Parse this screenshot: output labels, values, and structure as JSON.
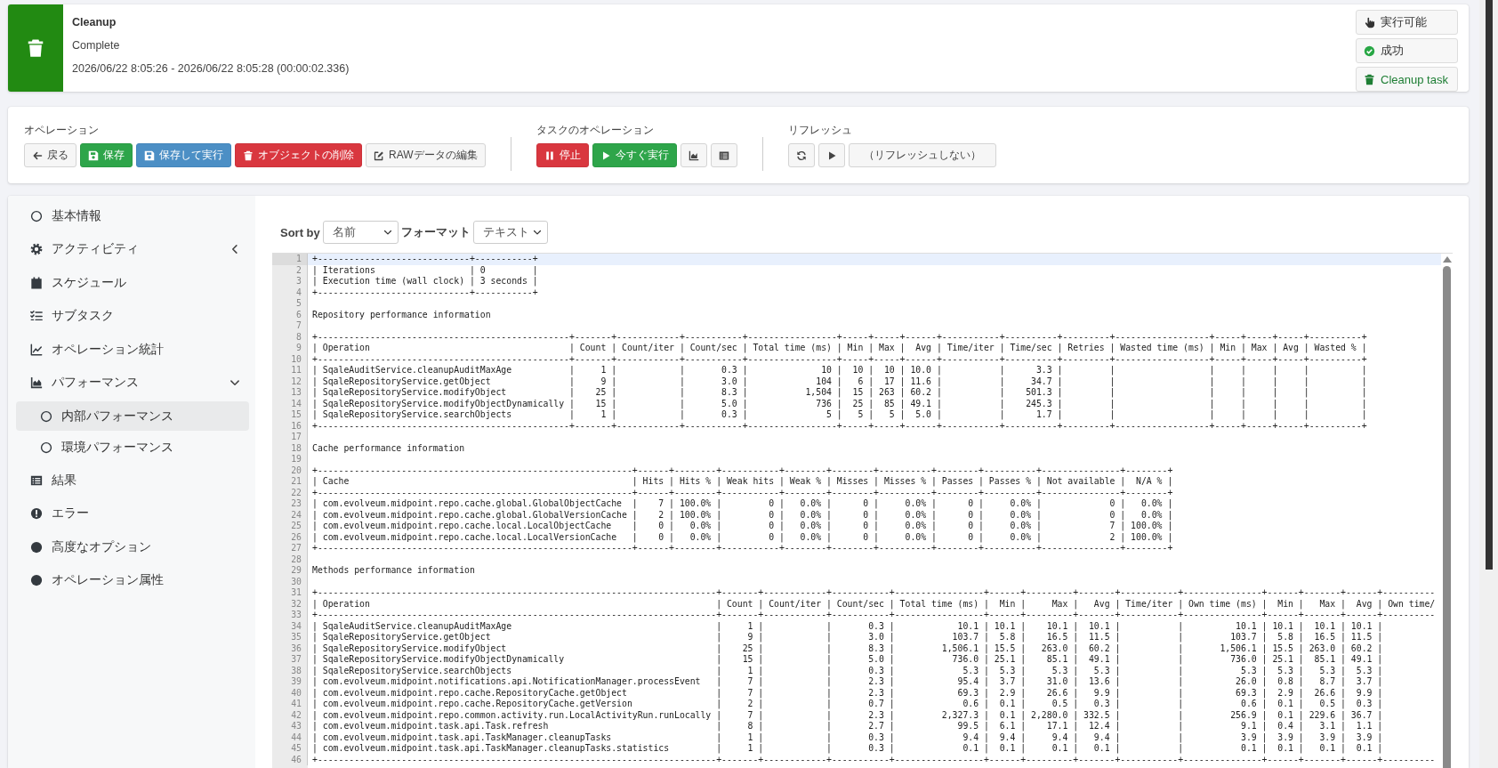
{
  "header": {
    "title": "Cleanup",
    "status": "Complete",
    "time": "2026/06/22 8:05:26 - 2026/06/22 8:05:28 (00:00:02.336)",
    "badges": [
      {
        "kind": "runnable",
        "label": "実行可能"
      },
      {
        "kind": "success",
        "label": "成功"
      },
      {
        "kind": "task",
        "label": "Cleanup task"
      }
    ]
  },
  "operations": {
    "groups": [
      {
        "label": "オペレーション",
        "buttons": [
          {
            "kind": "back",
            "label": "戻る"
          },
          {
            "kind": "save",
            "label": "保存"
          },
          {
            "kind": "save-run",
            "label": "保存して実行"
          },
          {
            "kind": "delete",
            "label": "オブジェクトの削除"
          },
          {
            "kind": "raw-edit",
            "label": "RAWデータの編集"
          }
        ]
      },
      {
        "label": "タスクのオペレーション",
        "buttons": [
          {
            "kind": "stop",
            "label": "停止"
          },
          {
            "kind": "run-now",
            "label": "今すぐ実行"
          },
          {
            "kind": "chart"
          },
          {
            "kind": "list"
          }
        ]
      },
      {
        "label": "リフレッシュ",
        "buttons": [
          {
            "kind": "refresh"
          },
          {
            "kind": "play"
          },
          {
            "kind": "refresh-mode",
            "label": "（リフレッシュしない）"
          }
        ]
      }
    ]
  },
  "sidebar": {
    "items": [
      {
        "kind": "basic",
        "label": "基本情報",
        "selected": false
      },
      {
        "kind": "activity",
        "label": "アクティビティ",
        "selected": false,
        "expanded": false
      },
      {
        "kind": "schedule",
        "label": "スケジュール",
        "selected": false
      },
      {
        "kind": "subtasks",
        "label": "サブタスク",
        "selected": false
      },
      {
        "kind": "statistics",
        "label": "オペレーション統計",
        "selected": false
      },
      {
        "kind": "performance",
        "label": "パフォーマンス",
        "selected": false,
        "expanded": true,
        "children": [
          {
            "label": "内部パフォーマンス",
            "selected": true
          },
          {
            "label": "環境パフォーマンス",
            "selected": false
          }
        ]
      },
      {
        "kind": "results",
        "label": "結果",
        "selected": false
      },
      {
        "kind": "errors",
        "label": "エラー",
        "selected": false
      },
      {
        "kind": "advanced",
        "label": "高度なオプション",
        "selected": false
      },
      {
        "kind": "attributes",
        "label": "オペレーション属性",
        "selected": false
      }
    ]
  },
  "report": {
    "sort": {
      "label": "Sort by",
      "value": "名前"
    },
    "format": {
      "label": "フォーマット",
      "value": "テキスト"
    },
    "editor": {
      "lines": [
        {
          "n": "1",
          "active": true,
          "text": "+-----------------------------+-----------+"
        },
        {
          "n": "2",
          "active": false,
          "text": "| Iterations                  | 0         |"
        },
        {
          "n": "3",
          "active": false,
          "text": "| Execution time (wall clock) | 3 seconds |"
        },
        {
          "n": "4",
          "active": false,
          "text": "+-----------------------------+-----------+"
        },
        {
          "n": "5",
          "active": false
        },
        {
          "n": "6",
          "active": false,
          "text": "Repository performance information"
        },
        {
          "n": "7",
          "active": false
        },
        {
          "n": "8",
          "active": false,
          "text": "+------------------------------------------------+-------+------------+-----------+-----------------+-----+-----+------+-----------+----------+---------+------------------+-----+-----+-----+----------+"
        },
        {
          "n": "9",
          "active": false,
          "text": "| Operation                                      | Count | Count/iter | Count/sec | Total time (ms) | Min | Max |  Avg | Time/iter | Time/sec | Retries | Wasted time (ms) | Min | Max | Avg | Wasted % |"
        },
        {
          "n": "10",
          "active": false,
          "text": "+------------------------------------------------+-------+------------+-----------+-----------------+-----+-----+------+-----------+----------+---------+------------------+-----+-----+-----+----------+"
        },
        {
          "n": "11",
          "active": false,
          "text": "| SqaleAuditService.cleanupAuditMaxAge           |     1 |            |       0.3 |              10 |  10 |  10 | 10.0 |           |      3.3 |         |                  |     |     |     |          |"
        },
        {
          "n": "12",
          "active": false,
          "text": "| SqaleRepositoryService.getObject               |     9 |            |       3.0 |             104 |   6 |  17 | 11.6 |           |     34.7 |         |                  |     |     |     |          |"
        },
        {
          "n": "13",
          "active": false,
          "text": "| SqaleRepositoryService.modifyObject            |    25 |            |       8.3 |           1,504 |  15 | 263 | 60.2 |           |    501.3 |         |                  |     |     |     |          |"
        },
        {
          "n": "14",
          "active": false,
          "text": "| SqaleRepositoryService.modifyObjectDynamically |    15 |            |       5.0 |             736 |  25 |  85 | 49.1 |           |    245.3 |         |                  |     |     |     |          |"
        },
        {
          "n": "15",
          "active": false,
          "text": "| SqaleRepositoryService.searchObjects           |     1 |            |       0.3 |               5 |   5 |   5 |  5.0 |           |      1.7 |         |                  |     |     |     |          |"
        },
        {
          "n": "16",
          "active": false,
          "text": "+------------------------------------------------+-------+------------+-----------+-----------------+-----+-----+------+-----------+----------+---------+------------------+-----+-----+-----+----------+"
        },
        {
          "n": "17",
          "active": false
        },
        {
          "n": "18",
          "active": false,
          "text": "Cache performance information"
        },
        {
          "n": "19",
          "active": false
        },
        {
          "n": "20",
          "active": false,
          "text": "+------------------------------------------------------------+------+--------+-----------+--------+--------+----------+--------+----------+---------------+--------+"
        },
        {
          "n": "21",
          "active": false,
          "text": "| Cache                                                      | Hits | Hits % | Weak hits | Weak % | Misses | Misses % | Passes | Passes % | Not available |  N/A % |"
        },
        {
          "n": "22",
          "active": false,
          "text": "+------------------------------------------------------------+------+--------+-----------+--------+--------+----------+--------+----------+---------------+--------+"
        },
        {
          "n": "23",
          "active": false,
          "text": "| com.evolveum.midpoint.repo.cache.global.GlobalObjectCache  |    7 | 100.0% |         0 |   0.0% |      0 |     0.0% |      0 |     0.0% |             0 |   0.0% |"
        },
        {
          "n": "24",
          "active": false,
          "text": "| com.evolveum.midpoint.repo.cache.global.GlobalVersionCache |    2 | 100.0% |         0 |   0.0% |      0 |     0.0% |      0 |     0.0% |             0 |   0.0% |"
        },
        {
          "n": "25",
          "active": false,
          "text": "| com.evolveum.midpoint.repo.cache.local.LocalObjectCache    |    0 |   0.0% |         0 |   0.0% |      0 |     0.0% |      0 |     0.0% |             7 | 100.0% |"
        },
        {
          "n": "26",
          "active": false,
          "text": "| com.evolveum.midpoint.repo.cache.local.LocalVersionCache   |    0 |   0.0% |         0 |   0.0% |      0 |     0.0% |      0 |     0.0% |             2 | 100.0% |"
        },
        {
          "n": "27",
          "active": false,
          "text": "+------------------------------------------------------------+------+--------+-----------+--------+--------+----------+--------+----------+---------------+--------+"
        },
        {
          "n": "28",
          "active": false
        },
        {
          "n": "29",
          "active": false,
          "text": "Methods performance information"
        },
        {
          "n": "30",
          "active": false
        },
        {
          "n": "31",
          "active": false,
          "text": "+----------------------------------------------------------------------------+-------+------------+-----------+-----------------+------+---------+-------+-----------+---------------+------+-------+------+----------"
        },
        {
          "n": "32",
          "active": false,
          "text": "| Operation                                                                  | Count | Count/iter | Count/sec | Total time (ms) |  Min |     Max |   Avg | Time/iter | Own time (ms) |  Min |   Max |  Avg | Own time/"
        },
        {
          "n": "33",
          "active": false,
          "text": "+----------------------------------------------------------------------------+-------+------------+-----------+-----------------+------+---------+-------+-----------+---------------+------+-------+------+----------"
        },
        {
          "n": "34",
          "active": false,
          "text": "| SqaleAuditService.cleanupAuditMaxAge                                       |     1 |            |       0.3 |            10.1 | 10.1 |    10.1 |  10.1 |           |          10.1 | 10.1 |  10.1 | 10.1 |"
        },
        {
          "n": "35",
          "active": false,
          "text": "| SqaleRepositoryService.getObject                                           |     9 |            |       3.0 |           103.7 |  5.8 |    16.5 |  11.5 |           |         103.7 |  5.8 |  16.5 | 11.5 |"
        },
        {
          "n": "36",
          "active": false,
          "text": "| SqaleRepositoryService.modifyObject                                        |    25 |            |       8.3 |         1,506.1 | 15.5 |   263.0 |  60.2 |           |       1,506.1 | 15.5 | 263.0 | 60.2 |"
        },
        {
          "n": "37",
          "active": false,
          "text": "| SqaleRepositoryService.modifyObjectDynamically                             |    15 |            |       5.0 |           736.0 | 25.1 |    85.1 |  49.1 |           |         736.0 | 25.1 |  85.1 | 49.1 |"
        },
        {
          "n": "38",
          "active": false,
          "text": "| SqaleRepositoryService.searchObjects                                       |     1 |            |       0.3 |             5.3 |  5.3 |     5.3 |   5.3 |           |           5.3 |  5.3 |   5.3 |  5.3 |"
        },
        {
          "n": "39",
          "active": false,
          "text": "| com.evolveum.midpoint.notifications.api.NotificationManager.processEvent   |     7 |            |       2.3 |            95.4 |  3.7 |    31.0 |  13.6 |           |          26.0 |  0.8 |   8.7 |  3.7 |"
        },
        {
          "n": "40",
          "active": false,
          "text": "| com.evolveum.midpoint.repo.cache.RepositoryCache.getObject                 |     7 |            |       2.3 |            69.3 |  2.9 |    26.6 |   9.9 |           |          69.3 |  2.9 |  26.6 |  9.9 |"
        },
        {
          "n": "41",
          "active": false,
          "text": "| com.evolveum.midpoint.repo.cache.RepositoryCache.getVersion                |     2 |            |       0.7 |             0.6 |  0.1 |     0.5 |   0.3 |           |           0.6 |  0.1 |   0.5 |  0.3 |"
        },
        {
          "n": "42",
          "active": false,
          "text": "| com.evolveum.midpoint.repo.common.activity.run.LocalActivityRun.runLocally |     7 |            |       2.3 |         2,327.3 |  0.1 | 2,280.0 | 332.5 |           |         256.9 |  0.1 | 229.6 | 36.7 |"
        },
        {
          "n": "43",
          "active": false,
          "text": "| com.evolveum.midpoint.task.api.Task.refresh                                |     8 |            |       2.7 |            99.5 |  6.1 |    17.1 |  12.4 |           |           9.1 |  0.4 |   3.1 |  1.1 |"
        },
        {
          "n": "44",
          "active": false,
          "text": "| com.evolveum.midpoint.task.api.TaskManager.cleanupTasks                    |     1 |            |       0.3 |             9.4 |  9.4 |     9.4 |   9.4 |           |           3.9 |  3.9 |   3.9 |  3.9 |"
        },
        {
          "n": "45",
          "active": false,
          "text": "| com.evolveum.midpoint.task.api.TaskManager.cleanupTasks.statistics         |     1 |            |       0.3 |             0.1 |  0.1 |     0.1 |   0.1 |           |           0.1 |  0.1 |   0.1 |  0.1 |"
        },
        {
          "n": "46",
          "active": false,
          "text": "+----------------------------------------------------------------------------+-------+------------+-----------+-----------------+------+---------+-------+-----------+---------------+------+-------+------+----------"
        }
      ]
    }
  }
}
